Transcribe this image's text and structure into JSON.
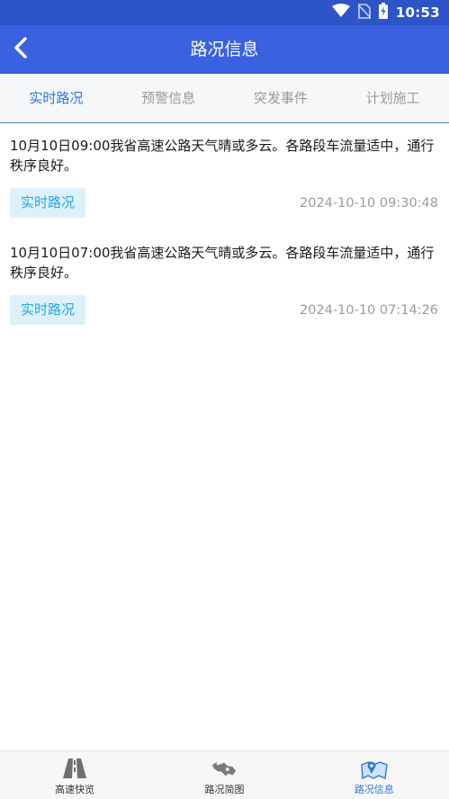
{
  "status_bar": {
    "time": "10:53"
  },
  "app_bar": {
    "title": "路况信息"
  },
  "tabs": [
    {
      "label": "实时路况",
      "active": true
    },
    {
      "label": "预警信息",
      "active": false
    },
    {
      "label": "突发事件",
      "active": false
    },
    {
      "label": "计划施工",
      "active": false
    }
  ],
  "items": [
    {
      "text": "10月10日09:00我省高速公路天气晴或多云。各路段车流量适中，通行秩序良好。",
      "tag": "实时路况",
      "time": "2024-10-10 09:30:48"
    },
    {
      "text": "10月10日07:00我省高速公路天气晴或多云。各路段车流量适中，通行秩序良好。",
      "tag": "实时路况",
      "time": "2024-10-10 07:14:26"
    }
  ],
  "bottom_nav": [
    {
      "label": "高速快览",
      "icon": "highway-icon",
      "active": false
    },
    {
      "label": "路况简图",
      "icon": "road-map-icon",
      "active": false
    },
    {
      "label": "路况信息",
      "icon": "traffic-info-icon",
      "active": true
    }
  ],
  "colors": {
    "status_bar": "#2d55c8",
    "app_bar": "#3a62e0",
    "accent": "#2f77d8",
    "tag_bg": "#def1fb",
    "tag_text": "#27a6dc"
  }
}
